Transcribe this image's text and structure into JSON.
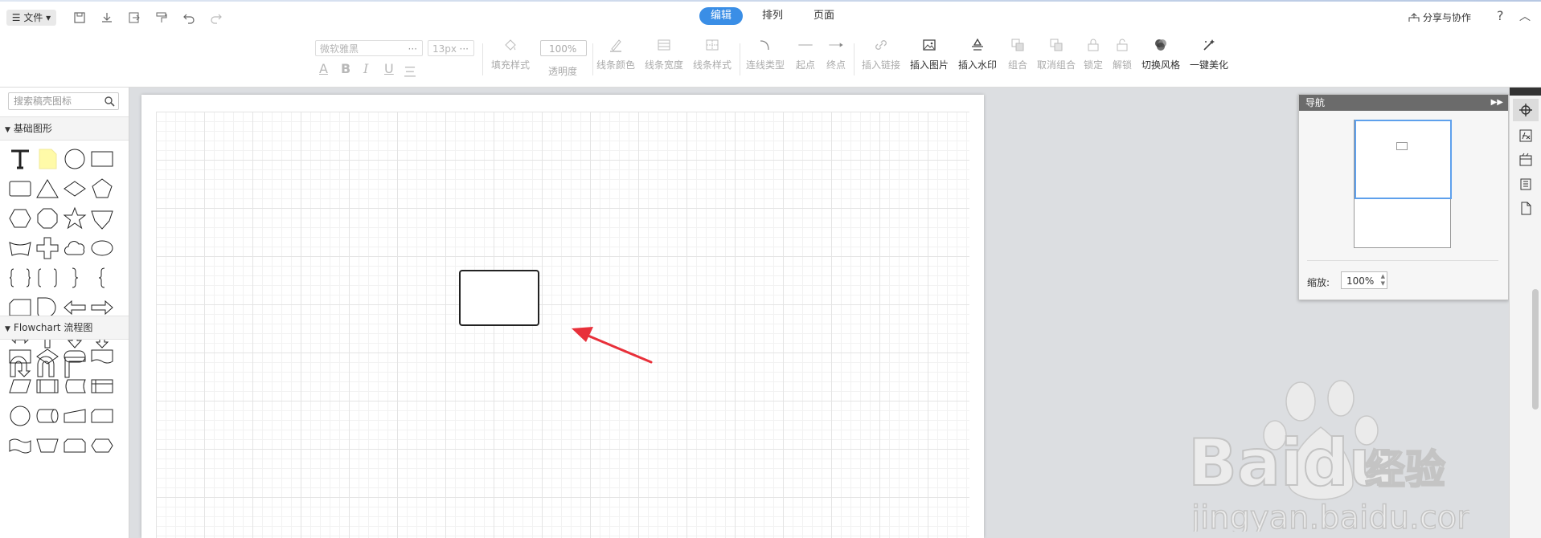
{
  "file_menu": {
    "label": "☰ 文件 ▾"
  },
  "modes": {
    "tabs": [
      {
        "label": "编辑"
      },
      {
        "label": "排列"
      },
      {
        "label": "页面"
      }
    ]
  },
  "header": {
    "share_label": "分享与协作",
    "help_label": "?",
    "collapse_label": "︿"
  },
  "font": {
    "family": "微软雅黑",
    "size": "13px",
    "more": "···"
  },
  "opacity": {
    "value": "100%",
    "label": "透明度"
  },
  "format_buttons": [
    "A",
    "B",
    "I",
    "U",
    "三"
  ],
  "toolbar": [
    {
      "label": "填充样式",
      "icon": "fill-icon",
      "enabled": false
    },
    {
      "label": "线条颜色",
      "icon": "line-color-icon",
      "enabled": false
    },
    {
      "label": "线条宽度",
      "icon": "line-width-icon",
      "enabled": false
    },
    {
      "label": "线条样式",
      "icon": "line-style-icon",
      "enabled": false
    },
    {
      "label": "连线类型",
      "icon": "connector-type-icon",
      "enabled": false
    },
    {
      "label": "起点",
      "icon": "line-start-icon",
      "enabled": false
    },
    {
      "label": "终点",
      "icon": "line-end-icon",
      "enabled": false
    },
    {
      "label": "插入链接",
      "icon": "link-icon",
      "enabled": false
    },
    {
      "label": "插入图片",
      "icon": "image-icon",
      "enabled": true
    },
    {
      "label": "插入水印",
      "icon": "watermark-icon",
      "enabled": true
    },
    {
      "label": "组合",
      "icon": "group-icon",
      "enabled": false
    },
    {
      "label": "取消组合",
      "icon": "ungroup-icon",
      "enabled": false
    },
    {
      "label": "锁定",
      "icon": "lock-icon",
      "enabled": false
    },
    {
      "label": "解锁",
      "icon": "unlock-icon",
      "enabled": false
    },
    {
      "label": "切换风格",
      "icon": "style-icon",
      "enabled": true
    },
    {
      "label": "一键美化",
      "icon": "beautify-icon",
      "enabled": true
    }
  ],
  "sidebar": {
    "search_placeholder": "搜索稿壳图标",
    "sections": [
      {
        "title": "基础图形"
      },
      {
        "title": "Flowchart 流程图"
      }
    ]
  },
  "navigator": {
    "title": "导航",
    "zoom_label": "缩放:",
    "zoom_value": "100%"
  },
  "watermark": {
    "brand": "Baidu",
    "brand_cn": "经验",
    "url": "jingyan.baidu.com"
  },
  "colors": {
    "accent": "#3a8ee6",
    "arrow": "#e8303a",
    "nav_viewport": "#5ea0ec"
  }
}
